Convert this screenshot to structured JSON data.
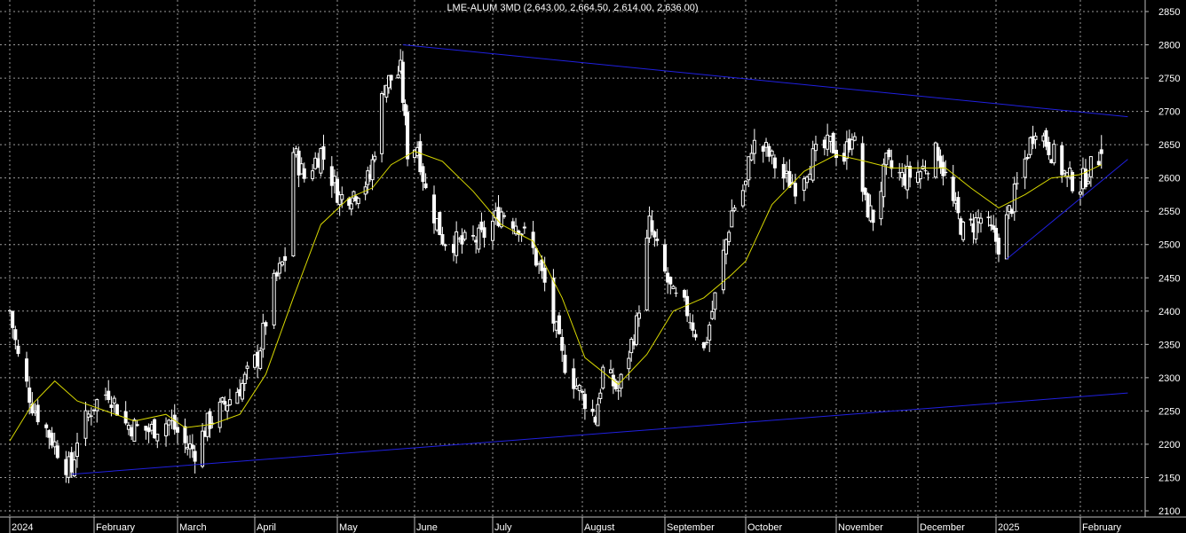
{
  "chart_data": {
    "type": "candlestick",
    "title": "LME-ALUM 3MD (2,643.00, 2,664.50, 2,614.00, 2,636.00)",
    "ylim": [
      2100,
      2850
    ],
    "y_ticks": [
      2100,
      2150,
      2200,
      2250,
      2300,
      2350,
      2400,
      2450,
      2500,
      2550,
      2600,
      2650,
      2700,
      2750,
      2800,
      2850
    ],
    "x_labels": [
      "2024",
      "February",
      "March",
      "April",
      "May",
      "June",
      "July",
      "August",
      "September",
      "October",
      "November",
      "December",
      "2025",
      "February"
    ],
    "grid": true,
    "colors": {
      "background": "#000000",
      "grid": "#9a9a9a",
      "candle": "#ffffff",
      "moving_average": "#d8d800",
      "trendline": "#2020e0",
      "text": "#ffffff"
    },
    "close_path": [
      [
        "2024-01-02",
        2400
      ],
      [
        "2024-01-05",
        2330
      ],
      [
        "2024-01-10",
        2260
      ],
      [
        "2024-01-16",
        2215
      ],
      [
        "2024-01-22",
        2170
      ],
      [
        "2024-01-24",
        2160
      ],
      [
        "2024-01-26",
        2210
      ],
      [
        "2024-02-01",
        2260
      ],
      [
        "2024-02-06",
        2280
      ],
      [
        "2024-02-12",
        2230
      ],
      [
        "2024-02-20",
        2220
      ],
      [
        "2024-02-27",
        2235
      ],
      [
        "2024-03-04",
        2200
      ],
      [
        "2024-03-08",
        2190
      ],
      [
        "2024-03-13",
        2230
      ],
      [
        "2024-03-20",
        2260
      ],
      [
        "2024-03-27",
        2290
      ],
      [
        "2024-04-02",
        2330
      ],
      [
        "2024-04-08",
        2440
      ],
      [
        "2024-04-12",
        2480
      ],
      [
        "2024-04-15",
        2640
      ],
      [
        "2024-04-19",
        2600
      ],
      [
        "2024-04-25",
        2640
      ],
      [
        "2024-05-02",
        2570
      ],
      [
        "2024-05-09",
        2580
      ],
      [
        "2024-05-15",
        2600
      ],
      [
        "2024-05-21",
        2740
      ],
      [
        "2024-05-28",
        2760
      ],
      [
        "2024-05-31",
        2640
      ],
      [
        "2024-06-04",
        2650
      ],
      [
        "2024-06-07",
        2580
      ],
      [
        "2024-06-13",
        2510
      ],
      [
        "2024-06-20",
        2500
      ],
      [
        "2024-06-27",
        2510
      ],
      [
        "2024-07-04",
        2550
      ],
      [
        "2024-07-10",
        2530
      ],
      [
        "2024-07-15",
        2490
      ],
      [
        "2024-07-19",
        2440
      ],
      [
        "2024-07-25",
        2330
      ],
      [
        "2024-07-31",
        2280
      ],
      [
        "2024-08-06",
        2240
      ],
      [
        "2024-08-09",
        2310
      ],
      [
        "2024-08-15",
        2280
      ],
      [
        "2024-08-22",
        2380
      ],
      [
        "2024-08-27",
        2530
      ],
      [
        "2024-08-30",
        2490
      ],
      [
        "2024-09-05",
        2420
      ],
      [
        "2024-09-10",
        2400
      ],
      [
        "2024-09-16",
        2340
      ],
      [
        "2024-09-20",
        2420
      ],
      [
        "2024-09-26",
        2550
      ],
      [
        "2024-10-01",
        2590
      ],
      [
        "2024-10-03",
        2650
      ],
      [
        "2024-10-08",
        2640
      ],
      [
        "2024-10-14",
        2600
      ],
      [
        "2024-10-18",
        2590
      ],
      [
        "2024-10-24",
        2630
      ],
      [
        "2024-10-30",
        2650
      ],
      [
        "2024-11-04",
        2630
      ],
      [
        "2024-11-07",
        2670
      ],
      [
        "2024-11-12",
        2560
      ],
      [
        "2024-11-15",
        2540
      ],
      [
        "2024-11-20",
        2620
      ],
      [
        "2024-11-26",
        2600
      ],
      [
        "2024-12-03",
        2610
      ],
      [
        "2024-12-10",
        2640
      ],
      [
        "2024-12-16",
        2560
      ],
      [
        "2024-12-20",
        2520
      ],
      [
        "2024-12-27",
        2540
      ],
      [
        "2025-01-03",
        2500
      ],
      [
        "2025-01-08",
        2560
      ],
      [
        "2025-01-14",
        2640
      ],
      [
        "2025-01-17",
        2680
      ],
      [
        "2025-01-23",
        2640
      ],
      [
        "2025-01-29",
        2600
      ],
      [
        "2025-02-03",
        2590
      ],
      [
        "2025-02-06",
        2610
      ],
      [
        "2025-02-11",
        2636
      ]
    ],
    "moving_average": [
      [
        "2024-01-02",
        2205
      ],
      [
        "2024-01-10",
        2260
      ],
      [
        "2024-01-18",
        2295
      ],
      [
        "2024-01-26",
        2265
      ],
      [
        "2024-02-05",
        2250
      ],
      [
        "2024-02-15",
        2235
      ],
      [
        "2024-02-26",
        2245
      ],
      [
        "2024-03-04",
        2225
      ],
      [
        "2024-03-15",
        2230
      ],
      [
        "2024-03-26",
        2245
      ],
      [
        "2024-04-05",
        2305
      ],
      [
        "2024-04-15",
        2420
      ],
      [
        "2024-04-25",
        2530
      ],
      [
        "2024-05-06",
        2570
      ],
      [
        "2024-05-16",
        2585
      ],
      [
        "2024-05-24",
        2620
      ],
      [
        "2024-06-03",
        2640
      ],
      [
        "2024-06-13",
        2625
      ],
      [
        "2024-06-24",
        2580
      ],
      [
        "2024-07-04",
        2530
      ],
      [
        "2024-07-15",
        2505
      ],
      [
        "2024-07-25",
        2420
      ],
      [
        "2024-08-02",
        2330
      ],
      [
        "2024-08-15",
        2290
      ],
      [
        "2024-08-26",
        2335
      ],
      [
        "2024-09-05",
        2400
      ],
      [
        "2024-09-16",
        2420
      ],
      [
        "2024-09-26",
        2455
      ],
      [
        "2024-10-01",
        2475
      ],
      [
        "2024-10-10",
        2560
      ],
      [
        "2024-10-21",
        2610
      ],
      [
        "2024-11-01",
        2635
      ],
      [
        "2024-11-12",
        2625
      ],
      [
        "2024-11-22",
        2615
      ],
      [
        "2024-12-03",
        2615
      ],
      [
        "2024-12-13",
        2615
      ],
      [
        "2024-12-23",
        2585
      ],
      [
        "2025-01-03",
        2555
      ],
      [
        "2025-01-13",
        2575
      ],
      [
        "2025-01-23",
        2600
      ],
      [
        "2025-02-03",
        2605
      ],
      [
        "2025-02-11",
        2620
      ]
    ],
    "trendlines": [
      {
        "from": [
          "2024-05-29",
          2800
        ],
        "to": [
          "2025-02-21",
          2692
        ]
      },
      {
        "from": [
          "2024-01-24",
          2155
        ],
        "to": [
          "2025-02-21",
          2277
        ]
      },
      {
        "from": [
          "2025-01-06",
          2478
        ],
        "to": [
          "2025-02-21",
          2628
        ]
      }
    ]
  }
}
